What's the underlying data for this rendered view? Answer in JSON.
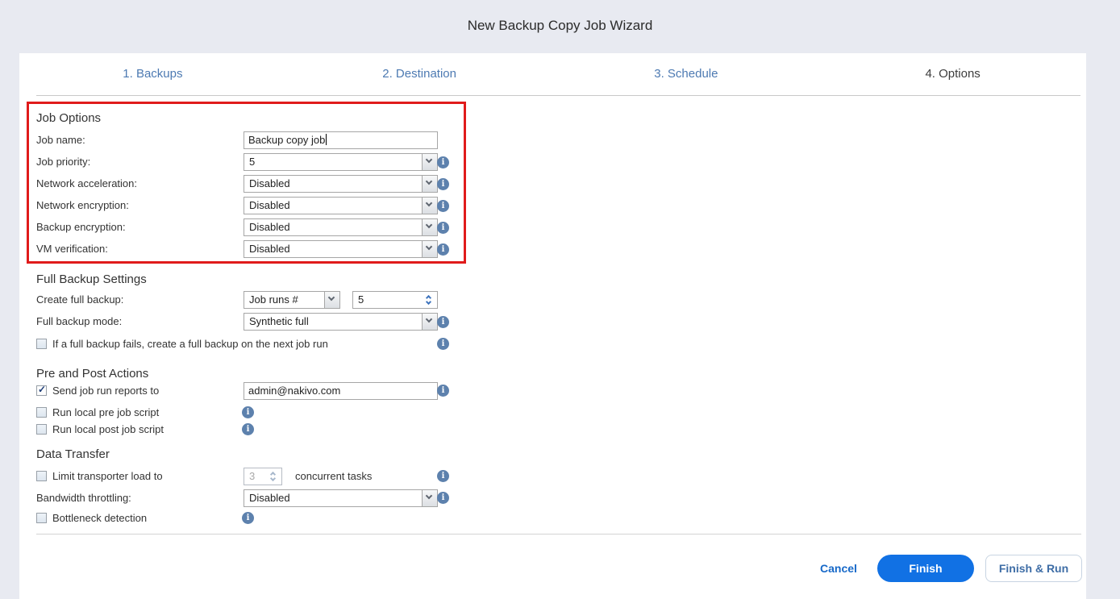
{
  "window": {
    "title": "New Backup Copy Job Wizard"
  },
  "tabs": [
    {
      "label": "1. Backups",
      "active": false
    },
    {
      "label": "2. Destination",
      "active": false
    },
    {
      "label": "3. Schedule",
      "active": false
    },
    {
      "label": "4. Options",
      "active": true
    }
  ],
  "job_options": {
    "heading": "Job Options",
    "job_name_label": "Job name:",
    "job_name_value": "Backup copy job",
    "job_priority_label": "Job priority:",
    "job_priority_value": "5",
    "network_acceleration_label": "Network acceleration:",
    "network_acceleration_value": "Disabled",
    "network_encryption_label": "Network encryption:",
    "network_encryption_value": "Disabled",
    "backup_encryption_label": "Backup encryption:",
    "backup_encryption_value": "Disabled",
    "vm_verification_label": "VM verification:",
    "vm_verification_value": "Disabled"
  },
  "full_backup_settings": {
    "heading": "Full Backup Settings",
    "create_full_backup_label": "Create full backup:",
    "create_full_backup_mode": "Job runs #",
    "create_full_backup_count": "5",
    "full_backup_mode_label": "Full backup mode:",
    "full_backup_mode_value": "Synthetic full",
    "fail_retry_label": "If a full backup fails, create a full backup on the next job run",
    "fail_retry_checked": false
  },
  "pre_post_actions": {
    "heading": "Pre and Post Actions",
    "send_reports_label": "Send job run reports to",
    "send_reports_checked": true,
    "send_reports_email": "admin@nakivo.com",
    "pre_script_label": "Run local pre job script",
    "pre_script_checked": false,
    "post_script_label": "Run local post job script",
    "post_script_checked": false
  },
  "data_transfer": {
    "heading": "Data Transfer",
    "limit_load_label": "Limit transporter load to",
    "limit_load_checked": false,
    "limit_load_value": "3",
    "limit_load_suffix": "concurrent tasks",
    "bandwidth_label": "Bandwidth throttling:",
    "bandwidth_value": "Disabled",
    "bottleneck_label": "Bottleneck detection",
    "bottleneck_checked": false
  },
  "footer": {
    "cancel_label": "Cancel",
    "finish_label": "Finish",
    "finish_run_label": "Finish & Run"
  },
  "colors": {
    "accent_blue": "#1171e4",
    "link_blue": "#1668c8",
    "tab_blue": "#4d7ab2",
    "highlight_red": "#e01b1b",
    "info_icon_blue": "#5d81ad",
    "background": "#e8eaf1"
  }
}
